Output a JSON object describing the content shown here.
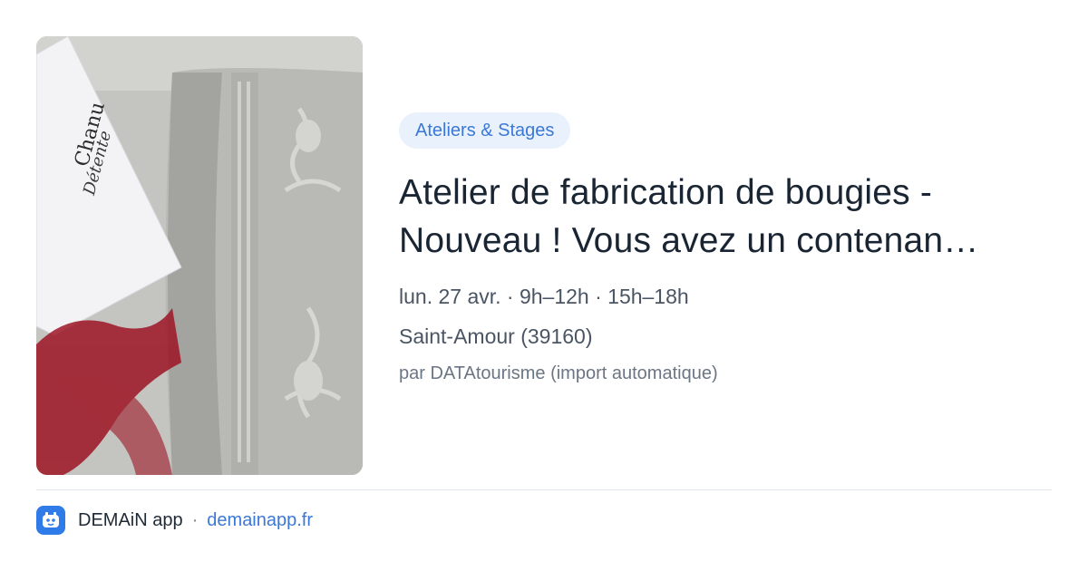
{
  "card": {
    "image_alt": "Bougie dans un contenant décoré avec étiquette et ruban rouge",
    "image_card_text_1": "Chanu",
    "image_card_text_2": "Détente",
    "category": "Ateliers & Stages",
    "title": "Atelier de fabrication de bougies - Nouveau ! Vous avez un contenan…",
    "datetime": "lun. 27 avr. · 9h–12h · 15h–18h",
    "location": "Saint-Amour (39160)",
    "source": "par DATAtourisme (import automatique)"
  },
  "footer": {
    "app_name": "DEMAiN app",
    "separator": "·",
    "url": "demainapp.fr",
    "icon": "app-logo-icon"
  },
  "colors": {
    "accent": "#3b78d6",
    "tag_background": "#e8f1fc",
    "title": "#1a2533",
    "meta": "#4a5564",
    "divider": "#dfe4ea",
    "app_icon": "#2f7be8"
  }
}
